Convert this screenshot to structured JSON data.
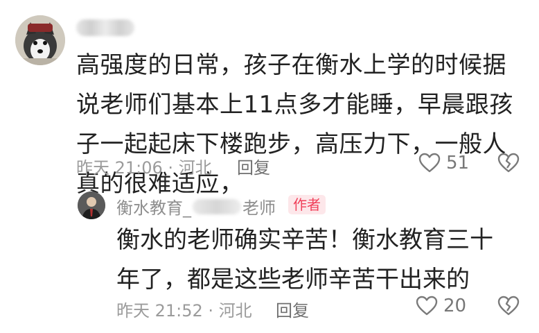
{
  "main_comment": {
    "text": "高强度的日常，孩子在衡水上学的时候据说老师们基本上11点多才能睡，早晨跟孩子一起起床下楼跑步，高压力下，一般人真的很难适应，",
    "time": "昨天 21:06",
    "location": "河北",
    "reply_label": "回复",
    "like_count": "51"
  },
  "reply": {
    "name_prefix": "衡水教育_",
    "name_suffix": "老师",
    "author_badge": "作者",
    "text": "衡水的老师确实辛苦！衡水教育三十年了，都是这些老师辛苦干出来的",
    "time": "昨天 21:52",
    "location": "河北",
    "reply_label": "回复",
    "like_count": "20"
  },
  "colors": {
    "text": "#222222",
    "meta": "#9b9b9b",
    "badge_bg": "#fde7ea",
    "badge_text": "#f0405a"
  },
  "icons": {
    "like": "heart-outline-icon",
    "dislike": "broken-heart-icon"
  }
}
